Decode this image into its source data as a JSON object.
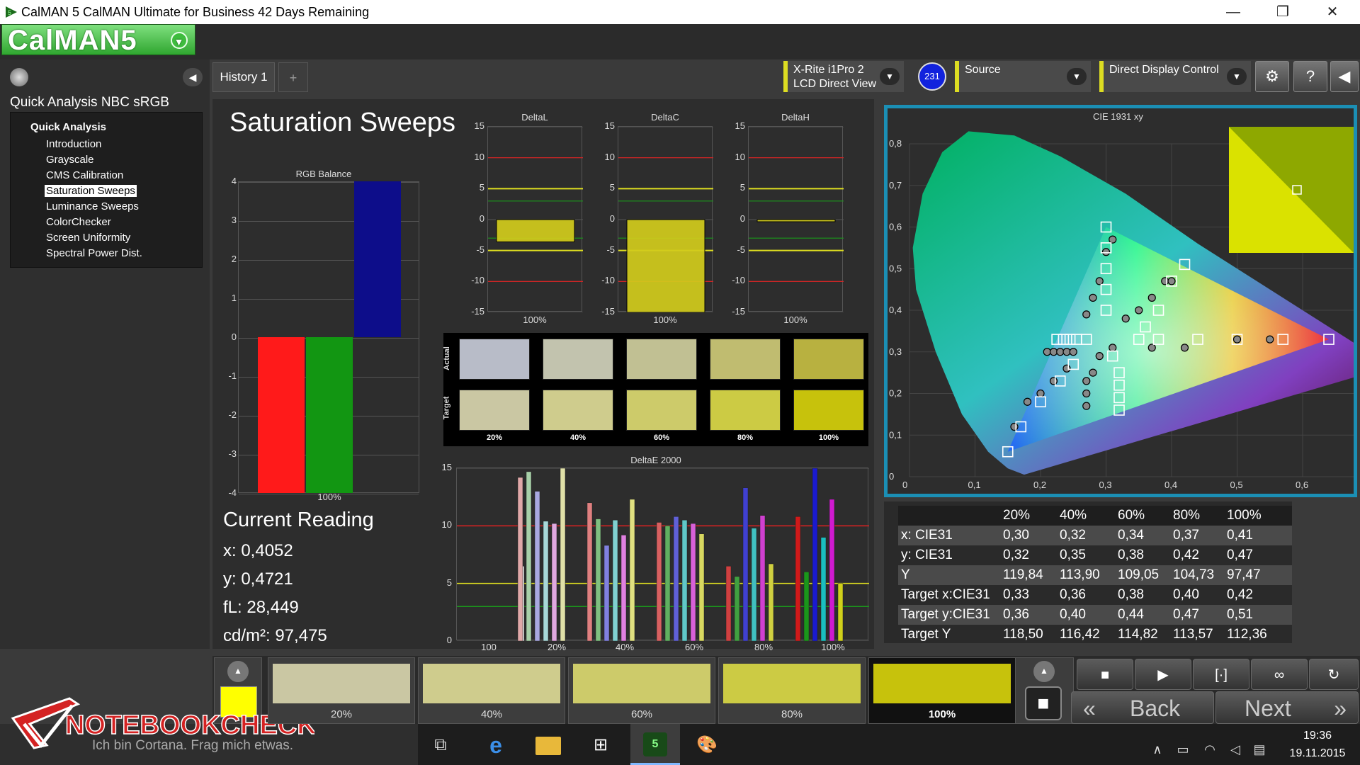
{
  "window": {
    "title": "CalMAN 5 CalMAN Ultimate for Business 42 Days Remaining",
    "minimize": "—",
    "restore": "❐",
    "close": "✕"
  },
  "logo": {
    "text": "CalMAN5",
    "dropdown": "▼"
  },
  "left_panel": {
    "title": "Quick Analysis NBC sRGB",
    "collapse": "◀",
    "section": "Quick Analysis",
    "items": [
      "Introduction",
      "Grayscale",
      "CMS Calibration",
      "Saturation Sweeps",
      "Luminance Sweeps",
      "ColorChecker",
      "Screen Uniformity",
      "Spectral Power Dist."
    ],
    "selected": "Saturation Sweeps"
  },
  "tabs": {
    "history": "History 1",
    "add": "+"
  },
  "devices": {
    "meter_line1": "X-Rite i1Pro 2",
    "meter_line2": "LCD Direct View",
    "badge": "231",
    "source": "Source",
    "display": "Direct Display Control",
    "chevron": "▼"
  },
  "toolbar": {
    "settings": "⚙",
    "help": "?",
    "back": "◀"
  },
  "page_title": "Saturation Sweeps",
  "rgb_balance": {
    "title": "RGB Balance",
    "yticks": [
      "4",
      "3",
      "2",
      "1",
      "0",
      "-1",
      "-2",
      "-3",
      "-4"
    ],
    "xlabel": "100%",
    "colors": {
      "red": "#ff1a1a",
      "green": "#129612",
      "blue": "#0d0d8a"
    }
  },
  "chart_data": [
    {
      "type": "bar",
      "title": "RGB Balance",
      "categories": [
        "100%"
      ],
      "series": [
        {
          "name": "Red",
          "values": [
            -4
          ]
        },
        {
          "name": "Green",
          "values": [
            -4
          ]
        },
        {
          "name": "Blue",
          "values": [
            4
          ]
        }
      ],
      "ylim": [
        -4,
        4
      ]
    },
    {
      "type": "bar",
      "title": "DeltaL",
      "categories": [
        "100%"
      ],
      "values": [
        -3.6
      ],
      "ylim": [
        -15,
        15
      ],
      "yticks": [
        "15",
        "10",
        "5",
        "0",
        "-5",
        "-10",
        "-15"
      ]
    },
    {
      "type": "bar",
      "title": "DeltaC",
      "categories": [
        "100%"
      ],
      "values": [
        -15
      ],
      "ylim": [
        -15,
        15
      ],
      "yticks": [
        "15",
        "10",
        "5",
        "0",
        "-5",
        "-10",
        "-15"
      ]
    },
    {
      "type": "bar",
      "title": "DeltaH",
      "categories": [
        "100%"
      ],
      "values": [
        -0.3
      ],
      "ylim": [
        -15,
        15
      ],
      "yticks": [
        "15",
        "10",
        "5",
        "0",
        "-5",
        "-10",
        "-15"
      ]
    },
    {
      "type": "bar",
      "title": "DeltaE 2000",
      "categories": [
        "100",
        "20%",
        "40%",
        "60%",
        "80%",
        "100%"
      ],
      "groups": [
        {
          "label": "100",
          "values": [
            6.5
          ]
        },
        {
          "label": "20%",
          "values": [
            14.2,
            14.7,
            13.0,
            10.4,
            10.2,
            15.0
          ]
        },
        {
          "label": "40%",
          "values": [
            12.0,
            10.6,
            8.3,
            10.5,
            9.2,
            12.3
          ]
        },
        {
          "label": "60%",
          "values": [
            10.3,
            10.0,
            10.8,
            10.5,
            10.2,
            9.3
          ]
        },
        {
          "label": "80%",
          "values": [
            6.5,
            5.6,
            13.3,
            9.8,
            10.9,
            6.7
          ]
        },
        {
          "label": "100%",
          "values": [
            10.8,
            6.0,
            15.0,
            9.0,
            12.3,
            5.0
          ]
        }
      ],
      "ylim": [
        0,
        15
      ],
      "yticks": [
        "15",
        "10",
        "5",
        "0"
      ]
    },
    {
      "type": "scatter",
      "title": "CIE 1931 xy",
      "xticks": [
        "0",
        "0,1",
        "0,2",
        "0,3",
        "0,4",
        "0,5",
        "0,6",
        "0,7",
        "0,8"
      ],
      "yticks": [
        "0",
        "0,1",
        "0,2",
        "0,3",
        "0,4",
        "0,5",
        "0,6",
        "0,7",
        "0,8"
      ],
      "xlim": [
        0,
        0.8
      ],
      "ylim": [
        0,
        0.8
      ],
      "series": [
        {
          "name": "Target",
          "x": [
            0.64,
            0.57,
            0.5,
            0.44,
            0.38,
            0.3,
            0.3,
            0.3,
            0.3,
            0.3,
            0.15,
            0.17,
            0.2,
            0.23,
            0.25,
            0.32,
            0.32,
            0.32,
            0.32,
            0.31,
            0.35,
            0.36,
            0.38,
            0.4,
            0.42,
            0.225,
            0.235,
            0.245,
            0.255,
            0.27
          ],
          "y": [
            0.33,
            0.33,
            0.33,
            0.33,
            0.33,
            0.6,
            0.55,
            0.5,
            0.45,
            0.4,
            0.06,
            0.12,
            0.18,
            0.23,
            0.27,
            0.16,
            0.19,
            0.22,
            0.25,
            0.29,
            0.33,
            0.36,
            0.4,
            0.47,
            0.51,
            0.33,
            0.33,
            0.33,
            0.33,
            0.33
          ]
        },
        {
          "name": "Actual",
          "x": [
            0.55,
            0.5,
            0.42,
            0.37,
            0.31,
            0.31,
            0.3,
            0.29,
            0.28,
            0.27,
            0.16,
            0.18,
            0.2,
            0.22,
            0.24,
            0.27,
            0.27,
            0.27,
            0.28,
            0.29,
            0.33,
            0.35,
            0.37,
            0.39,
            0.4,
            0.21,
            0.22,
            0.23,
            0.24,
            0.25
          ],
          "y": [
            0.33,
            0.33,
            0.31,
            0.31,
            0.31,
            0.57,
            0.54,
            0.47,
            0.43,
            0.39,
            0.12,
            0.18,
            0.2,
            0.23,
            0.26,
            0.17,
            0.2,
            0.23,
            0.25,
            0.29,
            0.38,
            0.4,
            0.43,
            0.47,
            0.47,
            0.3,
            0.3,
            0.3,
            0.3,
            0.3
          ]
        }
      ]
    }
  ],
  "delta_charts": [
    {
      "title": "DeltaL",
      "xlabel": "100%"
    },
    {
      "title": "DeltaC",
      "xlabel": "100%"
    },
    {
      "title": "DeltaH",
      "xlabel": "100%"
    }
  ],
  "swatches": {
    "row_labels": [
      "Actual",
      "Target"
    ],
    "col_labels": [
      "20%",
      "40%",
      "60%",
      "80%",
      "100%"
    ],
    "actual": [
      "#b8bcc8",
      "#c2c3ae",
      "#c1c093",
      "#c0bc70",
      "#b8b140"
    ],
    "target": [
      "#cac7a3",
      "#cfcc8d",
      "#cdcb6a",
      "#cccb44",
      "#c7c20c"
    ]
  },
  "deltae": {
    "title": "DeltaE 2000",
    "xlabels": [
      "100",
      "20%",
      "40%",
      "60%",
      "80%",
      "100%"
    ],
    "yticks": [
      "15",
      "10",
      "5",
      "0"
    ],
    "bar_colors": [
      "#e8a0a0",
      "#a8d8a8",
      "#a0a0e8",
      "#a0e0e0",
      "#e0a0e0",
      "#e8e8a0"
    ]
  },
  "cie": {
    "title": "CIE 1931 xy",
    "xticks": [
      "0",
      "0,1",
      "0,2",
      "0,3",
      "0,4",
      "0,5",
      "0,6",
      "0,7",
      "0,8"
    ],
    "yticks": [
      "0",
      "0,1",
      "0,2",
      "0,3",
      "0,4",
      "0,5",
      "0,6",
      "0,7",
      "0,8"
    ]
  },
  "current_reading": {
    "title": "Current Reading",
    "x": "x: 0,4052",
    "y": "y: 0,4721",
    "fL": "fL: 28,449",
    "cd": "cd/m²: 97,475"
  },
  "table": {
    "headers": [
      "20%",
      "40%",
      "60%",
      "80%",
      "100%"
    ],
    "rows": [
      {
        "label": "x: CIE31",
        "values": [
          "0,30",
          "0,32",
          "0,34",
          "0,37",
          "0,41"
        ]
      },
      {
        "label": "y: CIE31",
        "values": [
          "0,32",
          "0,35",
          "0,38",
          "0,42",
          "0,47"
        ]
      },
      {
        "label": "Y",
        "values": [
          "119,84",
          "113,90",
          "109,05",
          "104,73",
          "97,47"
        ]
      },
      {
        "label": "Target x:CIE31",
        "values": [
          "0,33",
          "0,36",
          "0,38",
          "0,40",
          "0,42"
        ]
      },
      {
        "label": "Target y:CIE31",
        "values": [
          "0,36",
          "0,40",
          "0,44",
          "0,47",
          "0,51"
        ]
      },
      {
        "label": "Target Y",
        "values": [
          "118,50",
          "116,42",
          "114,82",
          "113,57",
          "112,36"
        ]
      }
    ]
  },
  "bottom": {
    "swatches": [
      {
        "label": "20%",
        "color": "#cac7a3"
      },
      {
        "label": "40%",
        "color": "#cfcc8d"
      },
      {
        "label": "60%",
        "color": "#cdcb6a"
      },
      {
        "label": "80%",
        "color": "#cccb44"
      },
      {
        "label": "100%",
        "color": "#c7c20c"
      }
    ],
    "current_color": "#ffff00",
    "up": "▲",
    "back": "Back",
    "next": "Next",
    "back_icon": "«",
    "next_icon": "»",
    "stop": "■",
    "play": "▶",
    "fit": "[·]",
    "loop": "∞",
    "refresh": "↻"
  },
  "taskbar": {
    "watermark": "NOTEBOOKCHECK",
    "cortana": "Ich bin Cortana. Frag mich etwas.",
    "time": "19:36",
    "date": "19.11.2015",
    "badge5": "5"
  }
}
